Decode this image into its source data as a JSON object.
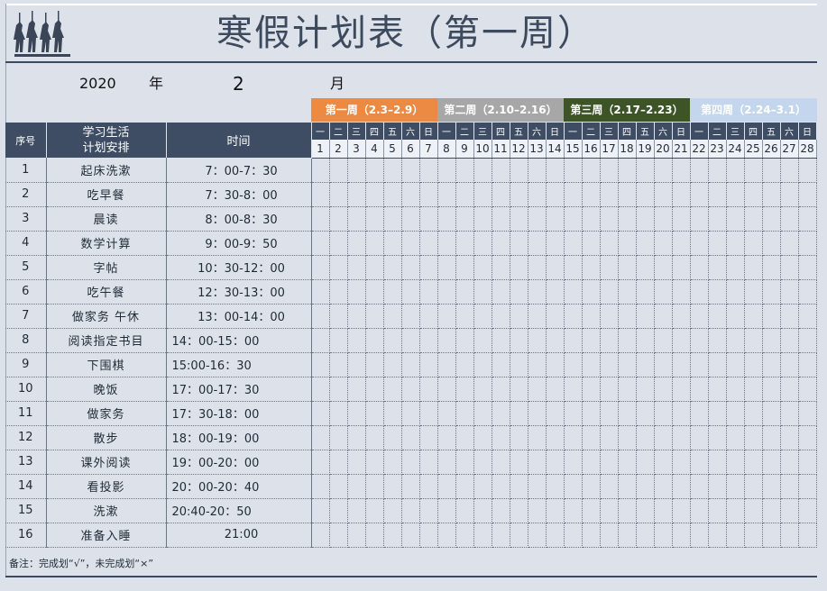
{
  "title": "寒假计划表（第一周）",
  "date": {
    "year": "2020",
    "year_label": "年",
    "month": "2",
    "month_label": "月"
  },
  "weeks": [
    {
      "label": "第一周（2.3–2.9）",
      "bg": "#ec8a43",
      "fg": "#ffffff"
    },
    {
      "label": "第二周（2.10–2.16）",
      "bg": "#a7a7a7",
      "fg": "#ffffff"
    },
    {
      "label": "第三周（2.17–2.23）",
      "bg": "#3d5427",
      "fg": "#ffffff"
    },
    {
      "label": "第四周（2.24–3.1）",
      "bg": "#c4d6ee",
      "fg": "#ffffff"
    }
  ],
  "columns": {
    "index": "序号",
    "activity": "学习生活\n计划安排",
    "time": "时间"
  },
  "weekday_labels": [
    "一",
    "二",
    "三",
    "四",
    "五",
    "六",
    "日",
    "一",
    "二",
    "三",
    "四",
    "五",
    "六",
    "日",
    "一",
    "二",
    "三",
    "四",
    "五",
    "六",
    "日",
    "一",
    "二",
    "三",
    "四",
    "五",
    "六",
    "日"
  ],
  "day_numbers": [
    "1",
    "2",
    "3",
    "4",
    "5",
    "6",
    "7",
    "8",
    "9",
    "10",
    "11",
    "12",
    "13",
    "14",
    "15",
    "16",
    "17",
    "18",
    "19",
    "20",
    "21",
    "22",
    "23",
    "24",
    "25",
    "26",
    "27",
    "28"
  ],
  "rows": [
    {
      "idx": "1",
      "activity": "起床洗漱",
      "time": "7：00-7：30",
      "center": true
    },
    {
      "idx": "2",
      "activity": "吃早餐",
      "time": "7：30-8：00",
      "center": true
    },
    {
      "idx": "3",
      "activity": "晨读",
      "time": "8：00-8：30",
      "center": true
    },
    {
      "idx": "4",
      "activity": "数学计算",
      "time": "9：00-9：50",
      "center": true
    },
    {
      "idx": "5",
      "activity": "字帖",
      "time": "10：30-12：00",
      "center": true
    },
    {
      "idx": "6",
      "activity": "吃午餐",
      "time": "12：30-13：00",
      "center": true
    },
    {
      "idx": "7",
      "activity": "做家务 午休",
      "time": "13：00-14：00",
      "center": true
    },
    {
      "idx": "8",
      "activity": "阅读指定书目",
      "time": "14：00-15：00",
      "center": false
    },
    {
      "idx": "9",
      "activity": "下围棋",
      "time": "15:00-16：30",
      "center": false
    },
    {
      "idx": "10",
      "activity": "晚饭",
      "time": "17：00-17：30",
      "center": false
    },
    {
      "idx": "11",
      "activity": "做家务",
      "time": "17：30-18：00",
      "center": false
    },
    {
      "idx": "12",
      "activity": "散步",
      "time": "18：00-19：00",
      "center": false
    },
    {
      "idx": "13",
      "activity": "课外阅读",
      "time": "19：00-20：00",
      "center": false
    },
    {
      "idx": "14",
      "activity": "看投影",
      "time": "20：00-20：40",
      "center": false
    },
    {
      "idx": "15",
      "activity": "洗漱",
      "time": "20:40-20：50",
      "center": false
    },
    {
      "idx": "16",
      "activity": "准备入睡",
      "time": "21:00",
      "center": true
    }
  ],
  "note": "备注：完成划“√”，未完成划“×”",
  "logo_icon": "soldiers-silhouette-icon"
}
